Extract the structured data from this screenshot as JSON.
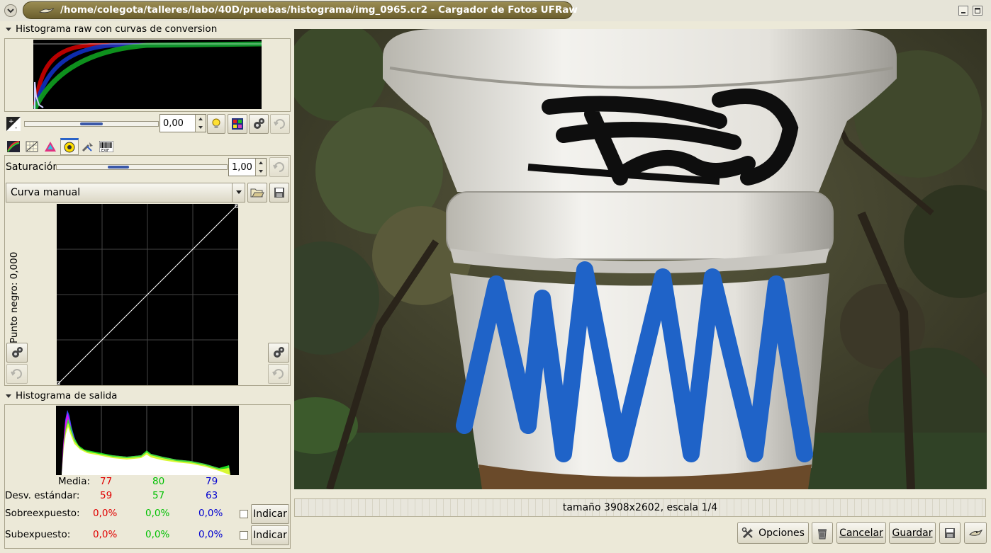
{
  "window": {
    "title": "/home/colegota/talleres/labo/40D/pruebas/histograma/img_0965.cr2 - Cargador de Fotos UFRaw"
  },
  "raw_histogram": {
    "header": "Histograma raw con curvas de conversion"
  },
  "exposure": {
    "value": "0,00"
  },
  "saturation": {
    "label": "Saturación",
    "value": "1,00"
  },
  "curve": {
    "selected": "Curva manual",
    "black_point_label": "Punto negro: 0,000"
  },
  "output_histogram": {
    "header": "Histograma de salida",
    "mean_label": "Media:",
    "mean": {
      "r": "77",
      "g": "80",
      "b": "79"
    },
    "std_label": "Desv. estándar:",
    "std": {
      "r": "59",
      "g": "57",
      "b": "63"
    },
    "over_label": "Sobreexpuesto:",
    "over": {
      "r": "0,0%",
      "g": "0,0%",
      "b": "0,0%"
    },
    "under_label": "Subexpuesto:",
    "under": {
      "r": "0,0%",
      "g": "0,0%",
      "b": "0,0%"
    },
    "indicate_label": "Indicar"
  },
  "status": {
    "text": "tamaño 3908x2602, escala 1/4"
  },
  "buttons": {
    "options": "Opciones",
    "cancel": "Cancelar",
    "save": "Guardar"
  },
  "colors": {
    "title_bar": "#7d6f38",
    "red_channel": "#e00000",
    "green_channel": "#00c000",
    "blue_channel": "#0000d0",
    "accent": "#3a58a8"
  }
}
